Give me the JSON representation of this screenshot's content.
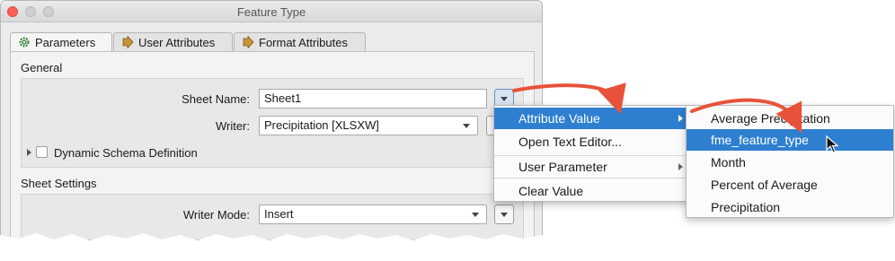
{
  "window": {
    "title": "Feature Type"
  },
  "tabs": [
    {
      "label": "Parameters",
      "icon": "gear-icon"
    },
    {
      "label": "User Attributes",
      "icon": "arrow-right-icon"
    },
    {
      "label": "Format Attributes",
      "icon": "arrow-right-icon"
    }
  ],
  "general": {
    "section_label": "General",
    "sheet_name_label": "Sheet Name:",
    "sheet_name_value": "Sheet1",
    "writer_label": "Writer:",
    "writer_value": "Precipitation [XLSXW]",
    "dynamic_schema_label": "Dynamic Schema Definition"
  },
  "sheet_settings": {
    "section_label": "Sheet Settings",
    "writer_mode_label": "Writer Mode:",
    "writer_mode_value": "Insert"
  },
  "context_menu": {
    "items": [
      {
        "label": "Attribute Value",
        "has_submenu": true,
        "highlighted": true
      },
      {
        "label": "Open Text Editor...",
        "has_submenu": false
      },
      {
        "label": "User Parameter",
        "has_submenu": true
      },
      {
        "label": "Clear Value",
        "has_submenu": false
      }
    ]
  },
  "attribute_submenu": {
    "items": [
      {
        "label": "Average Precipitation"
      },
      {
        "label": "fme_feature_type",
        "highlighted": true
      },
      {
        "label": "Month"
      },
      {
        "label": "Percent of Average"
      },
      {
        "label": "Precipitation"
      }
    ]
  },
  "colors": {
    "highlight": "#2f7fd1",
    "annotation_arrow": "#e8523a",
    "close_button": "#fc5f57"
  }
}
